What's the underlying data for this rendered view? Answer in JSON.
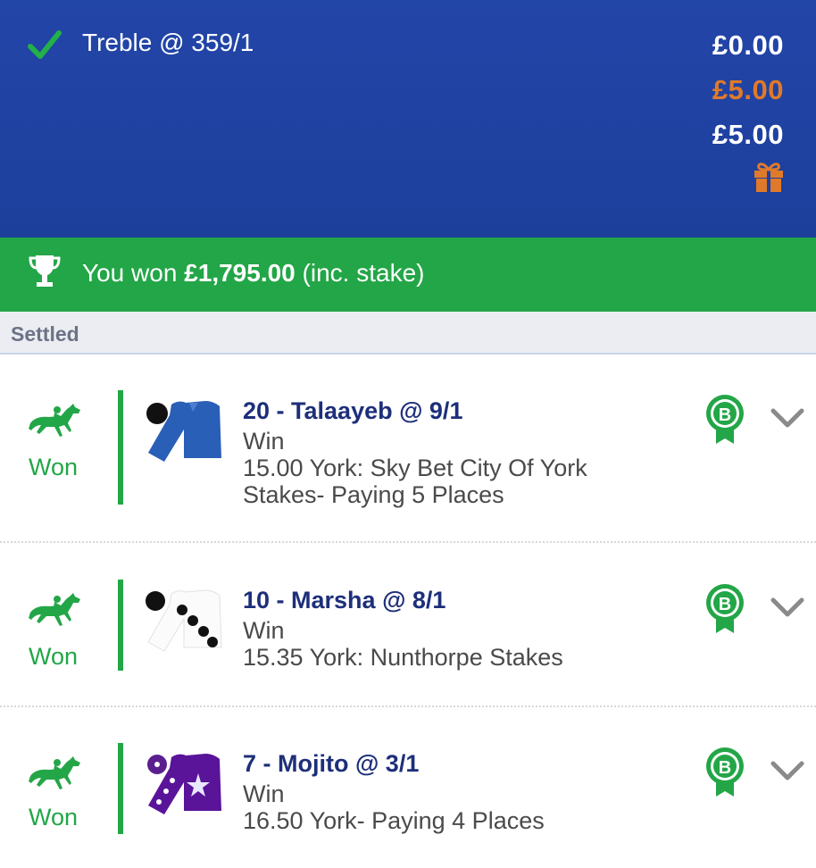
{
  "header": {
    "bet_title": "Treble @ 359/1",
    "amounts": [
      "£0.00",
      "£5.00",
      "£5.00"
    ],
    "accent_orange": "#e07a2a",
    "bg": "#1f42a2",
    "icons": [
      "check-icon",
      "gift-icon"
    ]
  },
  "won_bar": {
    "prefix": "You won ",
    "amount": "£1,795.00",
    "suffix": " (inc. stake)",
    "bg": "#23a647",
    "icon": "trophy-icon"
  },
  "section_label": "Settled",
  "selections": [
    {
      "status": "Won",
      "title": "20 - Talaayeb @ 9/1",
      "market": "Win",
      "event_lines": [
        "15.00 York: Sky Bet City Of York",
        "Stakes- Paying 5 Places"
      ],
      "boost_letter": "B",
      "silk": "blue-jacket-black-cap"
    },
    {
      "status": "Won",
      "title": "10 - Marsha @ 8/1",
      "market": "Win",
      "event_lines": [
        "15.35 York: Nunthorpe Stakes"
      ],
      "boost_letter": "B",
      "silk": "white-jacket-black-spots"
    },
    {
      "status": "Won",
      "title": "7 - Mojito @ 3/1",
      "market": "Win",
      "event_lines": [
        "16.50 York- Paying 4 Places"
      ],
      "boost_letter": "B",
      "silk": "purple-jacket-white-star"
    }
  ]
}
